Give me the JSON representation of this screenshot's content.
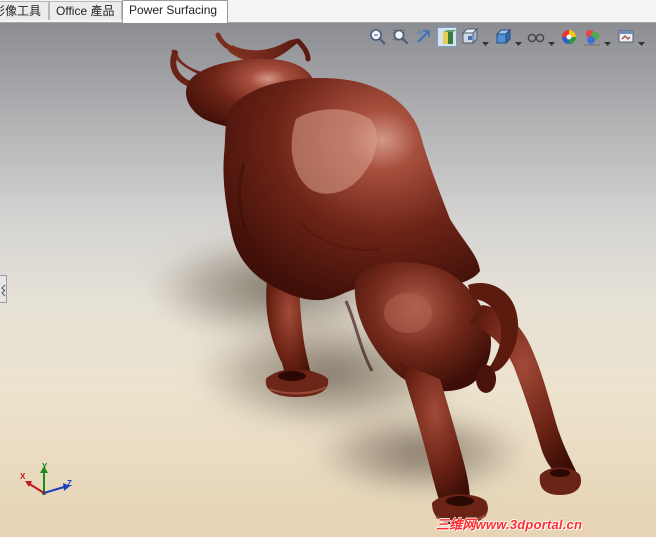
{
  "tabs": [
    {
      "label": "影像工具",
      "active": false
    },
    {
      "label": "Office 產品",
      "active": false
    },
    {
      "label": "Power Surfacing",
      "active": true
    }
  ],
  "hud_toolbar": {
    "buttons": [
      {
        "icon": "zoom-to-fit-icon"
      },
      {
        "icon": "zoom-to-area-icon"
      },
      {
        "icon": "previous-view-icon"
      },
      {
        "icon": "section-view-icon",
        "active": true
      },
      {
        "icon": "view-orientation-icon",
        "has_dropdown": true
      },
      {
        "icon": "display-style-icon",
        "has_dropdown": true
      },
      {
        "icon": "hide-show-items-icon",
        "has_dropdown": true
      },
      {
        "icon": "edit-appearance-icon"
      },
      {
        "icon": "apply-scene-icon",
        "has_dropdown": true
      },
      {
        "icon": "view-settings-icon",
        "has_dropdown": true
      }
    ]
  },
  "triad": {
    "x_label": "X",
    "y_label": "Y",
    "z_label": "Z"
  },
  "model": {
    "subject": "bull sculpture",
    "color": "#6e2417"
  },
  "watermark": {
    "text": "三维网www.3dportal.cn"
  },
  "colors": {
    "accent": "#7d9fc4",
    "model_body": "#6e2417",
    "model_highlight": "#c98a78",
    "watermark": "#ff2d2d"
  }
}
